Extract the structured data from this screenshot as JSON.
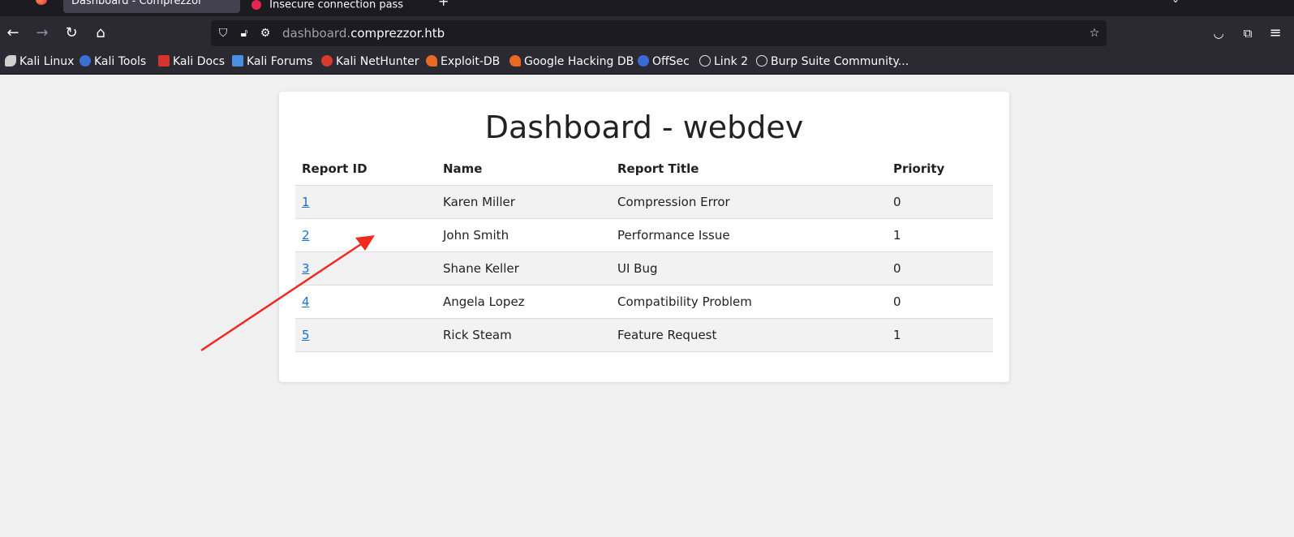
{
  "browser": {
    "tabs": [
      {
        "title": "Dashboard - Comprezzor",
        "active": true
      },
      {
        "title": "Insecure connection pass",
        "active": false
      }
    ],
    "url": {
      "subdomain": "dashboard.",
      "domain": "comprezzor.htb"
    },
    "bookmarks": [
      {
        "label": "Kali Linux",
        "icon": "kali-dragon-icon",
        "color": "#e6e6e6"
      },
      {
        "label": "Kali Tools",
        "icon": "kali-tools-icon",
        "color": "#3b6fd6"
      },
      {
        "label": "Kali Docs",
        "icon": "kali-docs-icon",
        "color": "#d6332d"
      },
      {
        "label": "Kali Forums",
        "icon": "kali-forums-icon",
        "color": "#4a90e2"
      },
      {
        "label": "Kali NetHunter",
        "icon": "nethunter-icon",
        "color": "#d63b2d"
      },
      {
        "label": "Exploit-DB",
        "icon": "exploit-db-icon",
        "color": "#e8691f"
      },
      {
        "label": "Google Hacking DB",
        "icon": "ghdb-icon",
        "color": "#e8691f"
      },
      {
        "label": "OffSec",
        "icon": "offsec-icon",
        "color": "#3a6bd4"
      },
      {
        "label": "Link 2",
        "icon": "globe-icon",
        "color": "#e6e6e6"
      },
      {
        "label": "Burp Suite Community...",
        "icon": "globe-icon",
        "color": "#e6e6e6"
      }
    ]
  },
  "page": {
    "title": "Dashboard - webdev",
    "table": {
      "headers": [
        "Report ID",
        "Name",
        "Report Title",
        "Priority"
      ],
      "rows": [
        {
          "id": "1",
          "name": "Karen Miller",
          "title": "Compression Error",
          "priority": "0"
        },
        {
          "id": "2",
          "name": "John Smith",
          "title": "Performance Issue",
          "priority": "1"
        },
        {
          "id": "3",
          "name": "Shane Keller",
          "title": "UI Bug",
          "priority": "0"
        },
        {
          "id": "4",
          "name": "Angela Lopez",
          "title": "Compatibility Problem",
          "priority": "0"
        },
        {
          "id": "5",
          "name": "Rick Steam",
          "title": "Feature Request",
          "priority": "1"
        }
      ]
    }
  },
  "annotation": {
    "color": "#ef2b1f"
  }
}
